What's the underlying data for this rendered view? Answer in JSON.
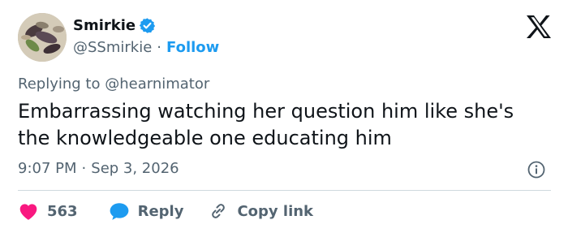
{
  "author": {
    "name": "Smirkie",
    "handle": "@SSmirkie",
    "separator": "·",
    "follow_label": "Follow"
  },
  "reply": {
    "prefix": "Replying to",
    "mention": "@hearnimator"
  },
  "tweet": {
    "text_line1": "Embarrassing watching her question him like she's",
    "text_line2": "the knowledgeable one educating him",
    "time": "9:07 PM",
    "separator": "·",
    "date": "Sep 3, 2026"
  },
  "actions": {
    "like_count": "563",
    "reply_label": "Reply",
    "copy_label": "Copy link"
  },
  "icons": {
    "verified": "verified-badge-icon",
    "logo": "x-logo-icon",
    "info": "info-icon",
    "like": "heart-icon",
    "reply": "speech-bubble-icon",
    "copy": "link-icon"
  },
  "colors": {
    "accent": "#1d9bf0",
    "like": "#f91880",
    "muted": "#536471",
    "text": "#0f1419"
  }
}
